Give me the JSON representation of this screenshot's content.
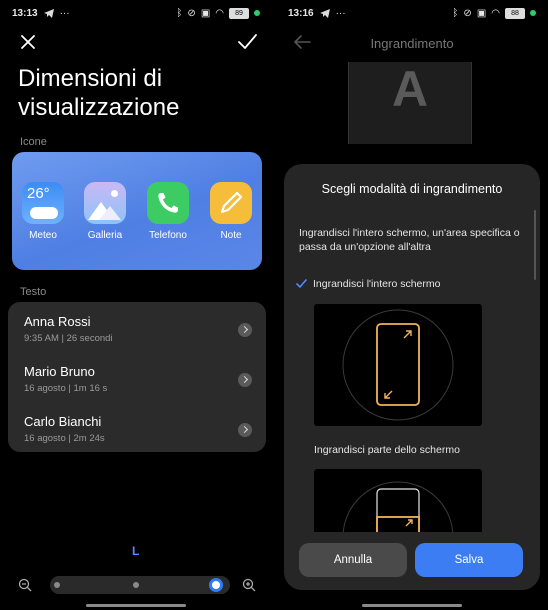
{
  "left_screen": {
    "status": {
      "time": "13:13",
      "battery": "89"
    },
    "title": "Dimensioni di visualizzazione",
    "icons_section_label": "Icone",
    "apps": [
      {
        "label": "Meteo",
        "icon": "weather-icon",
        "badge": "26°"
      },
      {
        "label": "Galleria",
        "icon": "gallery-icon"
      },
      {
        "label": "Telefono",
        "icon": "phone-icon"
      },
      {
        "label": "Note",
        "icon": "notes-icon"
      }
    ],
    "text_section_label": "Testo",
    "calls": [
      {
        "name": "Anna Rossi",
        "meta": "9:35 AM | 26 secondi"
      },
      {
        "name": "Mario Bruno",
        "meta": "16 agosto | 1m 16 s"
      },
      {
        "name": "Carlo Bianchi",
        "meta": "16 agosto | 2m 24s"
      }
    ],
    "size_letter": "L",
    "slider": {
      "steps": 3,
      "selected_index": 2
    },
    "accent_color": "#2f7cf6"
  },
  "right_screen": {
    "status": {
      "time": "13:16",
      "battery": "88"
    },
    "title": "Ingrandimento",
    "preview_letter": "A",
    "sheet": {
      "title": "Scegli modalità di ingrandimento",
      "description": "Ingrandisci l'intero schermo, un'area specifica o passa da un'opzione all'altra",
      "option_full": "Ingrandisci l'intero schermo",
      "option_full_selected": true,
      "option_partial": "Ingrandisci parte dello schermo",
      "cancel_label": "Annulla",
      "save_label": "Salva"
    },
    "illustration_color": "#f2b35a",
    "button_color": "#3d7df3"
  }
}
